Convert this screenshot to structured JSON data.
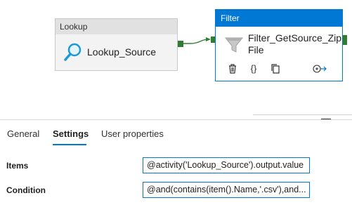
{
  "pipeline": {
    "lookup": {
      "type": "Lookup",
      "name": "Lookup_Source",
      "icon": "magnifier-icon"
    },
    "filter": {
      "type": "Filter",
      "name": "Filter_GetSource_ZipFile",
      "icon": "funnel-icon",
      "actions": [
        "delete-icon",
        "code-braces-icon",
        "copy-icon",
        "add-output-arrow-icon"
      ]
    },
    "colors": {
      "accent": "#0078d4",
      "connector": "#2e7d32"
    }
  },
  "tabs": [
    {
      "label": "General",
      "active": false
    },
    {
      "label": "Settings",
      "active": true
    },
    {
      "label": "User properties",
      "active": false
    }
  ],
  "settings": {
    "items": {
      "label": "Items",
      "value": "@activity('Lookup_Source').output.value"
    },
    "condition": {
      "label": "Condition",
      "value": "@and(contains(item().Name,'.csv'),and..."
    }
  }
}
